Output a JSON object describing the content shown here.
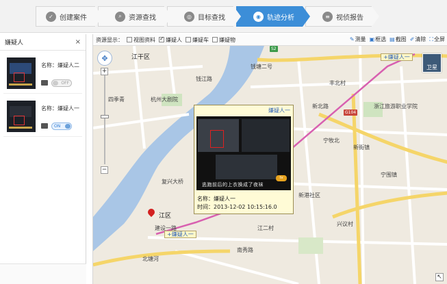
{
  "steps": [
    {
      "label": "创建案件",
      "icon": "check-icon"
    },
    {
      "label": "资源查找",
      "icon": "search-icon"
    },
    {
      "label": "目标查找",
      "icon": "target-icon"
    },
    {
      "label": "轨迹分析",
      "icon": "track-icon",
      "active": true
    },
    {
      "label": "视侦报告",
      "icon": "report-icon"
    }
  ],
  "left": {
    "title": "嫌疑人",
    "close": "×",
    "items": [
      {
        "name": "名称：嫌疑人二",
        "toggle": "OFF"
      },
      {
        "name": "名称：嫌疑人一",
        "toggle": "ON"
      }
    ]
  },
  "toolbar": {
    "resource_label": "资源显示：",
    "filters": [
      {
        "label": "视图资料",
        "checked": false
      },
      {
        "label": "嫌疑人",
        "checked": true
      },
      {
        "label": "嫌疑车",
        "checked": false
      },
      {
        "label": "嫌疑物",
        "checked": false
      }
    ],
    "tools": [
      "测量",
      "框选",
      "截图",
      "清除",
      "全屏"
    ]
  },
  "map": {
    "zoom_in": "+",
    "zoom_out": "−",
    "satellite": "卫星",
    "labels": {
      "district_top": "江干区",
      "district_bottom": "江区",
      "suspect_marker_top": "+嫌疑人一",
      "suspect_marker_bottom": "+嫌疑人一",
      "road_s2": "S2",
      "road_g104": "G104",
      "places": [
        "钱塘二号",
        "丰北村",
        "新北路",
        "四季青",
        "新街镇",
        "宁牧北",
        "兴议村",
        "杭州大剧院",
        "复兴大桥",
        "钱江路",
        "宁围镇",
        "浙江旅游职业学院",
        "新港社区",
        "建设一路",
        "北塘河",
        "江二村",
        "南秀路"
      ]
    }
  },
  "popup": {
    "title": "嫌疑人一",
    "name": "名称：嫌疑人一",
    "time": "时间：2013-12-02 10:15:16.0",
    "video_caption": "逃跑前后的上衣换成了夜袜",
    "video_logo": "tv"
  },
  "colors": {
    "accent": "#3c8ed8",
    "track": "#d860b0",
    "river": "#a9c6e6",
    "popup_bg": "#fffbd6"
  }
}
